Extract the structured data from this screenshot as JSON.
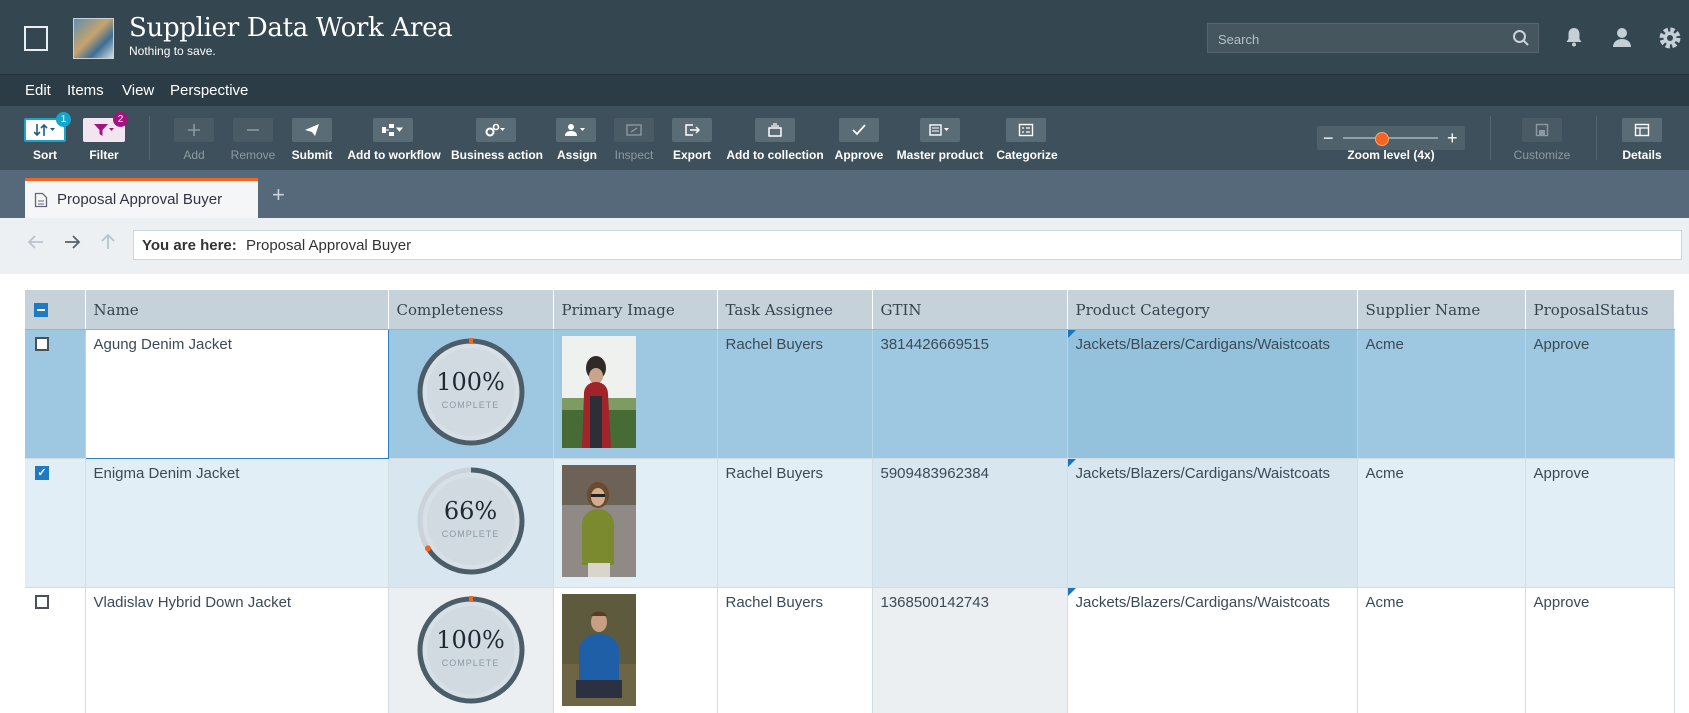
{
  "header": {
    "title": "Supplier Data Work Area",
    "subtitle": "Nothing to save.",
    "search_placeholder": "Search"
  },
  "menu": [
    "Edit",
    "Items",
    "View",
    "Perspective"
  ],
  "toolbar": {
    "sort": {
      "label": "Sort",
      "badge": "1",
      "badge_color": "#15a6c9"
    },
    "filter": {
      "label": "Filter",
      "badge": "2",
      "badge_color": "#a3137e"
    },
    "buttons": [
      {
        "label": "Add",
        "icon": "plus-icon",
        "enabled": false
      },
      {
        "label": "Remove",
        "icon": "minus-icon",
        "enabled": false
      },
      {
        "label": "Submit",
        "icon": "paper-plane-icon",
        "enabled": true
      },
      {
        "label": "Add to workflow",
        "icon": "workflow-icon",
        "enabled": true
      },
      {
        "label": "Business action",
        "icon": "gears-icon",
        "enabled": true
      },
      {
        "label": "Assign",
        "icon": "assign-user-icon",
        "enabled": true
      },
      {
        "label": "Inspect",
        "icon": "inspect-icon",
        "enabled": false
      },
      {
        "label": "Export",
        "icon": "export-icon",
        "enabled": true
      },
      {
        "label": "Add to collection",
        "icon": "collection-icon",
        "enabled": true
      },
      {
        "label": "Approve",
        "icon": "checkmark-icon",
        "enabled": true
      },
      {
        "label": "Master product",
        "icon": "master-product-icon",
        "enabled": true
      },
      {
        "label": "Categorize",
        "icon": "categorize-icon",
        "enabled": true
      }
    ],
    "zoom_label": "Zoom level (4x)",
    "zoom_level": 0.4,
    "customize_label": "Customize",
    "details_label": "Details"
  },
  "tab": {
    "label": "Proposal Approval Buyer",
    "icon": "document-icon"
  },
  "breadcrumb": {
    "prefix": "You are here:",
    "value": "Proposal Approval Buyer"
  },
  "grid": {
    "columns": [
      "Name",
      "Completeness",
      "Primary Image",
      "Task Assignee",
      "GTIN",
      "Product Category",
      "Supplier Name",
      "ProposalStatus"
    ],
    "completeness_sub": "COMPLETE",
    "rows": [
      {
        "checked": false,
        "name": "Agung Denim Jacket",
        "completeness": "100%",
        "completeness_value": 1.0,
        "image": "woman-beanie-red-jacket-photo",
        "assignee": "Rachel Buyers",
        "gtin": "3814426669515",
        "category": "Jackets/Blazers/Cardigans/Waistcoats",
        "supplier": "Acme",
        "status": "Approve"
      },
      {
        "checked": true,
        "name": "Enigma Denim Jacket",
        "completeness": "66%",
        "completeness_value": 0.66,
        "image": "woman-green-jacket-photo",
        "assignee": "Rachel Buyers",
        "gtin": "5909483962384",
        "category": "Jackets/Blazers/Cardigans/Waistcoats",
        "supplier": "Acme",
        "status": "Approve"
      },
      {
        "checked": false,
        "name": "Vladislav Hybrid Down Jacket",
        "completeness": "100%",
        "completeness_value": 1.0,
        "image": "man-blue-down-jacket-photo",
        "assignee": "Rachel Buyers",
        "gtin": "1368500142743",
        "category": "Jackets/Blazers/Cardigans/Waistcoats",
        "supplier": "Acme",
        "status": "Approve"
      }
    ]
  },
  "colors": {
    "accent": "#f26522",
    "header_bg": "#34464f",
    "selection": "#9ec8e2"
  }
}
